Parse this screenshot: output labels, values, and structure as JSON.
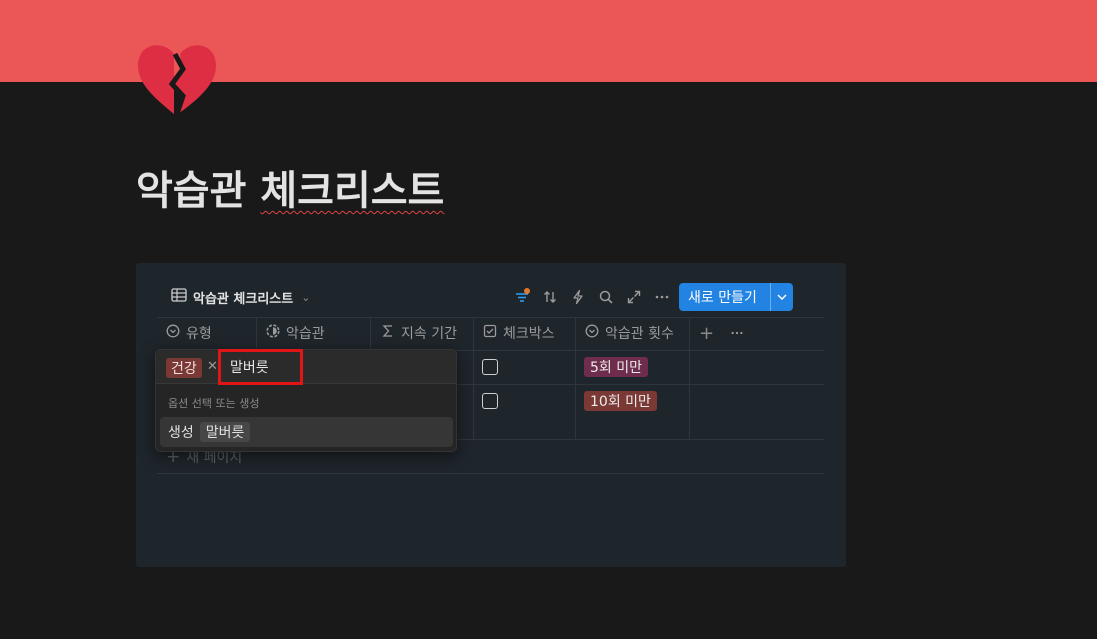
{
  "page": {
    "title_part1": "악습관",
    "title_part2": "체크리스트",
    "cover_color": "#eb5757",
    "icon_name": "broken-heart-icon"
  },
  "database": {
    "view_name": "악습관 체크리스트",
    "view_icon": "table-icon",
    "toolbar_icons": [
      "filter-icon",
      "sort-icon",
      "automation-icon",
      "search-icon",
      "expand-icon",
      "more-icon"
    ],
    "filter_active_color": "#e07a2c",
    "new_button_label": "새로 만들기",
    "accent_color": "#2383e2",
    "columns": [
      {
        "label": "유형",
        "icon": "select-icon"
      },
      {
        "label": "악습관",
        "icon": "status-icon"
      },
      {
        "label": "지속 기간",
        "icon": "sigma-icon"
      },
      {
        "label": "체크박스",
        "icon": "checkbox-icon"
      },
      {
        "label": "악습관 횟수",
        "icon": "select-icon"
      }
    ],
    "rows": [
      {
        "checked": false,
        "count_tag": "5회 미만",
        "count_tag_color": "#6e2d4d"
      },
      {
        "checked": false,
        "count_tag": "10회 미만",
        "count_tag_color": "#7a3935"
      }
    ],
    "new_page_label": "새 페이지"
  },
  "select_popup": {
    "selected_chip": "건강",
    "selected_chip_color": "#7a3935",
    "input_value": "말버릇",
    "hint": "옵션 선택 또는 생성",
    "create_label": "생성",
    "create_value": "말버릇"
  }
}
